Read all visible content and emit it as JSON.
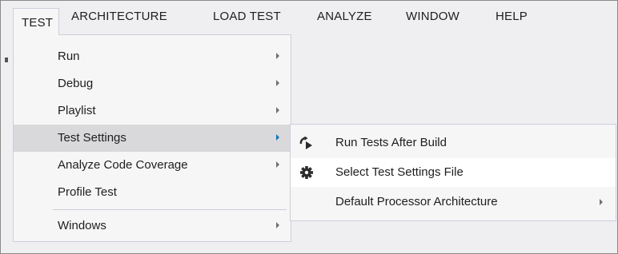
{
  "menubar": {
    "items": [
      {
        "label": "TEST"
      },
      {
        "label": "ARCHITECTURE"
      },
      {
        "label": "LOAD TEST"
      },
      {
        "label": "ANALYZE"
      },
      {
        "label": "WINDOW"
      },
      {
        "label": "HELP"
      }
    ]
  },
  "test_menu": {
    "items": [
      {
        "label": "Run",
        "has_submenu": true
      },
      {
        "label": "Debug",
        "has_submenu": true
      },
      {
        "label": "Playlist",
        "has_submenu": true
      },
      {
        "label": "Test Settings",
        "has_submenu": true,
        "highlighted": true
      },
      {
        "label": "Analyze Code Coverage",
        "has_submenu": true
      },
      {
        "label": "Profile Test",
        "has_submenu": false
      },
      {
        "label": "Windows",
        "has_submenu": true
      }
    ]
  },
  "test_settings_submenu": {
    "items": [
      {
        "label": "Run Tests After Build",
        "icon": "run-after-build-icon"
      },
      {
        "label": "Select Test Settings File",
        "icon": "gear-icon",
        "hovered": true
      },
      {
        "label": "Default Processor Architecture",
        "has_submenu": true
      }
    ]
  },
  "colors": {
    "accent": "#007acc",
    "menu_background": "#f6f6f6",
    "menu_border": "#cccedb",
    "highlight": "#d9d9dc",
    "text": "#1e1e1e"
  }
}
